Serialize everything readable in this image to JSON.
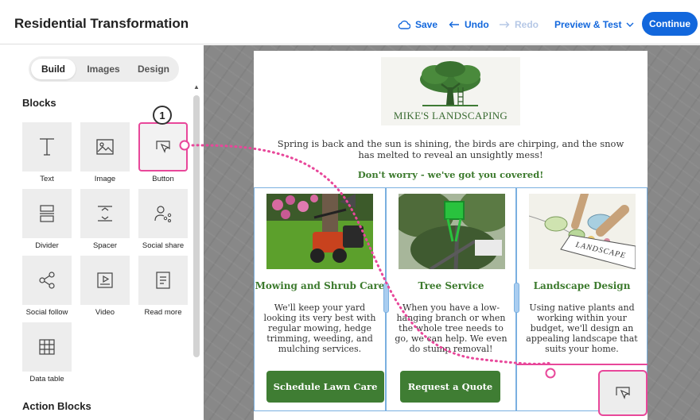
{
  "header": {
    "title": "Residential Transformation",
    "save": "Save",
    "undo": "Undo",
    "redo": "Redo",
    "preview": "Preview & Test",
    "continue": "Continue"
  },
  "sidebar": {
    "tabs": [
      "Build",
      "Images",
      "Design"
    ],
    "active_tab": "Build",
    "blocks_heading": "Blocks",
    "blocks": [
      {
        "label": "Text",
        "icon": "text-icon"
      },
      {
        "label": "Image",
        "icon": "image-icon"
      },
      {
        "label": "Button",
        "icon": "button-cursor-icon"
      },
      {
        "label": "Divider",
        "icon": "divider-icon"
      },
      {
        "label": "Spacer",
        "icon": "spacer-icon"
      },
      {
        "label": "Social share",
        "icon": "social-share-icon"
      },
      {
        "label": "Social follow",
        "icon": "share-nodes-icon"
      },
      {
        "label": "Video",
        "icon": "video-icon"
      },
      {
        "label": "Read more",
        "icon": "document-icon"
      },
      {
        "label": "Data table",
        "icon": "table-icon"
      }
    ],
    "action_blocks_heading": "Action Blocks"
  },
  "email": {
    "logo_text": "MIKE'S LANDSCAPING",
    "intro": "Spring is back and the sun is shining, the birds are chirping, and the snow has melted to reveal an unsightly mess!",
    "tagline": "Don't worry - we've got you covered!",
    "columns": [
      {
        "title": "Mowing and Shrub Care",
        "text": "We'll keep your yard looking its very best with regular mowing, hedge trimming, weeding, and mulching services.",
        "button": "Schedule Lawn Care"
      },
      {
        "title": "Tree Service",
        "text": "When you have a low-hanging branch or when the whole tree needs to go, we can help. We even do stump removal!",
        "button": "Request a Quote"
      },
      {
        "title": "Landscape Design",
        "text": "Using native plants and working within your budget, we'll design an appealing landscape that suits your home.",
        "image_caption": "LANDSCAPE"
      }
    ]
  },
  "annotation": {
    "step": "1"
  },
  "colors": {
    "accent": "#1267dc",
    "brand_green": "#3f7d33",
    "drag_highlight": "#e8479a",
    "column_outline": "#7ab0e0"
  }
}
